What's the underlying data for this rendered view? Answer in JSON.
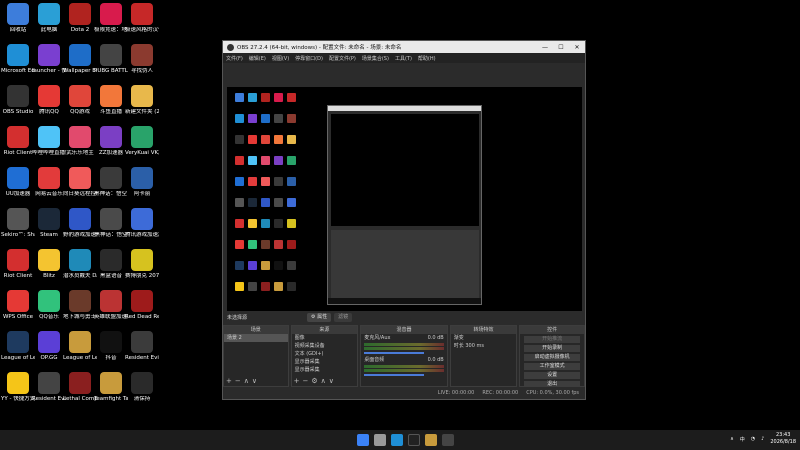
{
  "desktop": {
    "icons": [
      {
        "label": "回收站",
        "color": "#3d7ddb"
      },
      {
        "label": "此电脑",
        "color": "#2a9fd6"
      },
      {
        "label": "Dota 2",
        "color": "#b0231f"
      },
      {
        "label": "极限竞速：地平线 5",
        "color": "#d81b4c"
      },
      {
        "label": "极速风格的汉化程序",
        "color": "#c62828"
      },
      {
        "label": "Microsoft Edge",
        "color": "#1f8fd6"
      },
      {
        "label": "launcher - 快捷方式",
        "color": "#7a3fd0"
      },
      {
        "label": "Wallpaper Engine: ...",
        "color": "#1e6dc8"
      },
      {
        "label": "PUBG BATTLEGROUNDS",
        "color": "#444"
      },
      {
        "label": "寻找伪人",
        "color": "#8b3a2f"
      },
      {
        "label": "OBS Studio",
        "color": "#333"
      },
      {
        "label": "腾讯QQ",
        "color": "#e53935"
      },
      {
        "label": "QQ游戏",
        "color": "#e0463a"
      },
      {
        "label": "斗鱼直播",
        "color": "#f2773a"
      },
      {
        "label": "新建文件夹 (2)",
        "color": "#e8b84b"
      },
      {
        "label": "Riot Client",
        "color": "#d32f2f"
      },
      {
        "label": "哔哩哔哩直播姬",
        "color": "#4fc3f7"
      },
      {
        "label": "武乐乐地主",
        "color": "#e14a6d"
      },
      {
        "label": "ZZ加速器",
        "color": "#7b3fc4"
      },
      {
        "label": "VeryKuai VK加速器",
        "color": "#29a36a"
      },
      {
        "label": "UU加速器",
        "color": "#1f6ed4"
      },
      {
        "label": "网易云音乐",
        "color": "#e23b3b"
      },
      {
        "label": "向日葵远程控制",
        "color": "#f05a5a"
      },
      {
        "label": "黑神话：悟空 性能测试工具",
        "color": "#3a3a3a"
      },
      {
        "label": "阿卡丽",
        "color": "#2b5fa8"
      },
      {
        "label": "Sekiro™: Shadow...",
        "color": "#555"
      },
      {
        "label": "Steam",
        "color": "#1b2838"
      },
      {
        "label": "野豹游戏加速器",
        "color": "#2f57c7"
      },
      {
        "label": "黑神话：悟空",
        "color": "#4a4a4a"
      },
      {
        "label": "腾讯游戏加速加速器",
        "color": "#3d6bd8"
      },
      {
        "label": "Riot Client",
        "color": "#d32f2f"
      },
      {
        "label": "Blitz",
        "color": "#f4c430"
      },
      {
        "label": "潜水员戴夫 DAVE T...",
        "color": "#1f8ab8"
      },
      {
        "label": "黑盒语音",
        "color": "#2a2a2a"
      },
      {
        "label": "赛博朋克 2077",
        "color": "#d6c21f"
      },
      {
        "label": "WPS Office",
        "color": "#e53935"
      },
      {
        "label": "QQ音乐",
        "color": "#31c27c"
      },
      {
        "label": "地下城与勇士：创新世纪",
        "color": "#6a3a2a"
      },
      {
        "label": "英雄联盟加速器",
        "color": "#b33"
      },
      {
        "label": "Red Dead Redempti...",
        "color": "#9e1b1b"
      },
      {
        "label": "League of Legends",
        "color": "#1e3a5f"
      },
      {
        "label": "OP.GG",
        "color": "#5b3fd6"
      },
      {
        "label": "League of Legends - 快捷方式",
        "color": "#c89b3c"
      },
      {
        "label": "抖音",
        "color": "#111"
      },
      {
        "label": "Resident Evil Re...",
        "color": "#3b3b3b"
      },
      {
        "label": "YY - 快捷方式",
        "color": "#f5c518"
      },
      {
        "label": "Resident Evil 4",
        "color": "#444"
      },
      {
        "label": "Lethal Company",
        "color": "#8a1f1f"
      },
      {
        "label": "Teamfight Tactics",
        "color": "#c89b3c"
      },
      {
        "label": "清保持",
        "color": "#2a2a2a"
      }
    ]
  },
  "obs": {
    "title": "OBS 27.2.4 (64-bit, windows) - 配置文件: 未命名 - 场景: 未命名",
    "window_controls": [
      "—",
      "☐",
      "✕"
    ],
    "menu": [
      "文件(F)",
      "编辑(E)",
      "视图(V)",
      "停靠窗口(D)",
      "配置文件(P)",
      "场景集合(S)",
      "工具(T)",
      "帮助(H)"
    ],
    "source_bar": {
      "label": "未选择源",
      "properties": "⚙ 属性",
      "filters": "滤镜"
    },
    "scenes": {
      "header": "场景",
      "items": [
        "场景 2"
      ]
    },
    "sources": {
      "header": "来源",
      "items": [
        "图像",
        "视频采集设备",
        "文本 (GDI+)",
        "显示器采集",
        "显示器采集"
      ]
    },
    "mixer": {
      "header": "混音器",
      "tracks": [
        {
          "name": "麦克风/Aux",
          "db": "0.0 dB"
        },
        {
          "name": "桌面音频",
          "db": "0.0 dB"
        }
      ]
    },
    "transitions": {
      "header": "转场特效",
      "type": "渐变",
      "duration_label": "时长",
      "duration": "300 ms"
    },
    "controls": {
      "header": "控件",
      "buttons": [
        "开始推流",
        "开始录制",
        "启动虚拟摄像机",
        "工作室模式",
        "设置",
        "退出"
      ]
    },
    "status": {
      "live": "LIVE: 00:00:00",
      "rec": "REC: 00:00:00",
      "cpu": "CPU: 0.0%, 30.00 fps"
    }
  },
  "taskbar": {
    "tray": {
      "lang": "中",
      "time": "23:43",
      "date": "2026/8/18"
    }
  }
}
